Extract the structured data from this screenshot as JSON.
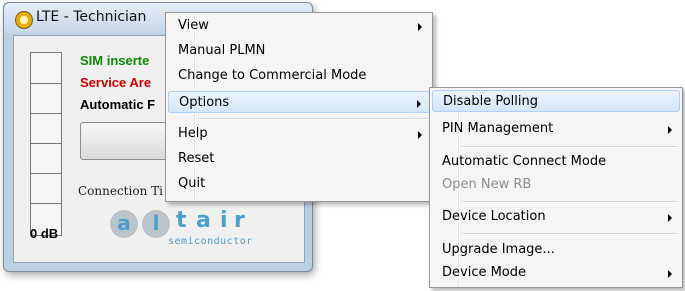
{
  "window": {
    "title": "LTE - Technician"
  },
  "status": {
    "sim": "SIM inserte",
    "service": "Service Are",
    "auto": "Automatic F"
  },
  "connection": {
    "time_label": "Connection Ti"
  },
  "signal": {
    "db_label": "0 dB"
  },
  "logo": {
    "letters": [
      "a",
      "l",
      "t",
      "a",
      "i",
      "r"
    ],
    "subtitle": "semiconductor"
  },
  "main_menu": {
    "items": [
      {
        "label": "View",
        "submenu": true
      },
      {
        "label": "Manual PLMN",
        "submenu": false
      },
      {
        "label": "Change to Commercial Mode",
        "submenu": false
      },
      {
        "label": "Options",
        "submenu": true,
        "highlighted": true
      },
      {
        "label": "Help",
        "submenu": true
      },
      {
        "label": "Reset",
        "submenu": false
      },
      {
        "label": "Quit",
        "submenu": false
      }
    ]
  },
  "options_menu": {
    "items": [
      {
        "label": "Disable Polling",
        "highlighted": true
      },
      {
        "label": "PIN Management",
        "submenu": true
      },
      {
        "label": "Automatic Connect Mode"
      },
      {
        "label": "Open New RB",
        "disabled": true
      },
      {
        "label": "Device Location",
        "submenu": true
      },
      {
        "label": "Upgrade Image..."
      },
      {
        "label": "Device Mode",
        "submenu": true
      }
    ]
  },
  "colors": {
    "menu_highlight": "#d3e7fa",
    "status_sim": "#0b8a0b",
    "status_service": "#d60000",
    "logo_blue": "#4aa0cc"
  }
}
